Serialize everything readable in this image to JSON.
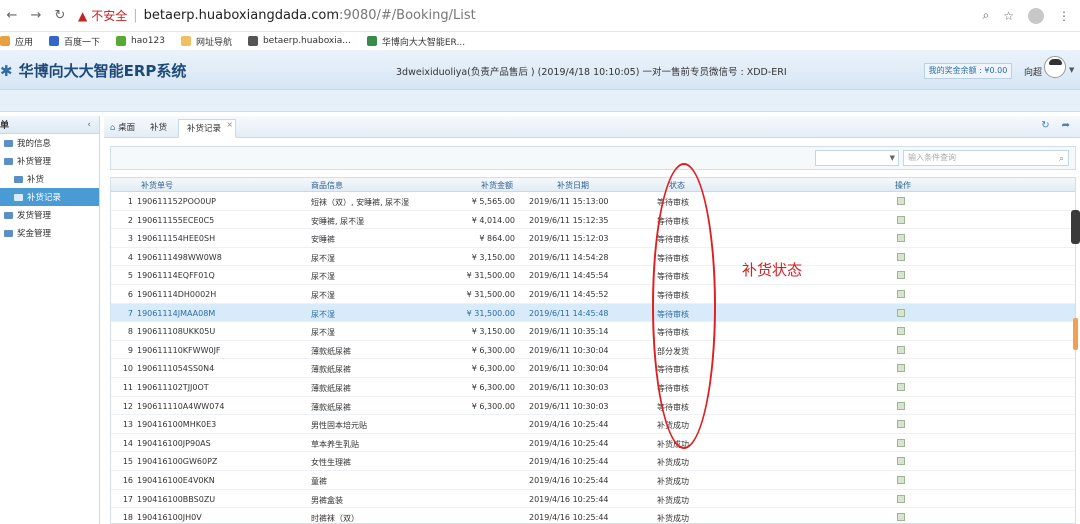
{
  "browser": {
    "insecure_label": "不安全",
    "url_host": "betaerp.huaboxiangdada.com",
    "url_path": ":9080/#/Booking/List",
    "bookmarks": [
      "应用",
      "百度一下",
      "hao123",
      "网址导航",
      "betaerp.huaboxia...",
      "华博向大大智能ER..."
    ]
  },
  "header": {
    "title": "华博向大大智能ERP系统",
    "notice": "3dweixiduoliya(负责产品售后 ) (2019/4/18 10:10:05) 一对一售前专员微信号 : XDD-ERI",
    "balance": "我的奖金余额 : ¥0.00",
    "user": "向超"
  },
  "sidebar": {
    "header": "单",
    "items": [
      {
        "label": "我的信息"
      },
      {
        "label": "补货管理"
      },
      {
        "label": "补货"
      },
      {
        "label": "补货记录"
      },
      {
        "label": "发货管理"
      },
      {
        "label": "奖金管理"
      }
    ]
  },
  "tabs": [
    "桌面",
    "补货",
    "补货记录"
  ],
  "toolbar": {
    "search_placeholder": "输入条件查询"
  },
  "table": {
    "columns": [
      "补货单号",
      "商品信息",
      "补货金额",
      "补货日期",
      "状态",
      "操作"
    ],
    "rows": [
      {
        "no": "1",
        "code": "190611152POO0UP",
        "goods": "短袜（双）, 安睡裤, 尿不湿",
        "amount": "¥ 5,565.00",
        "date": "2019/6/11 15:13:00",
        "status": "等待审核"
      },
      {
        "no": "2",
        "code": "190611155ECE0C5",
        "goods": "安睡裤, 尿不湿",
        "amount": "¥ 4,014.00",
        "date": "2019/6/11 15:12:35",
        "status": "等待审核"
      },
      {
        "no": "3",
        "code": "190611154HEE0SH",
        "goods": "安睡裤",
        "amount": "¥ 864.00",
        "date": "2019/6/11 15:12:03",
        "status": "等待审核"
      },
      {
        "no": "4",
        "code": "1906111498WW0W8",
        "goods": "尿不湿",
        "amount": "¥ 3,150.00",
        "date": "2019/6/11 14:54:28",
        "status": "等待审核"
      },
      {
        "no": "5",
        "code": "19061114EQFF01Q",
        "goods": "尿不湿",
        "amount": "¥ 31,500.00",
        "date": "2019/6/11 14:45:54",
        "status": "等待审核"
      },
      {
        "no": "6",
        "code": "19061114DH0002H",
        "goods": "尿不湿",
        "amount": "¥ 31,500.00",
        "date": "2019/6/11 14:45:52",
        "status": "等待审核"
      },
      {
        "no": "7",
        "code": "19061114JMAA08M",
        "goods": "尿不湿",
        "amount": "¥ 31,500.00",
        "date": "2019/6/11 14:45:48",
        "status": "等待审核"
      },
      {
        "no": "8",
        "code": "190611108UKK05U",
        "goods": "尿不湿",
        "amount": "¥ 3,150.00",
        "date": "2019/6/11 10:35:14",
        "status": "等待审核"
      },
      {
        "no": "9",
        "code": "190611110KFWW0JF",
        "goods": "薄款纸尿裤",
        "amount": "¥ 6,300.00",
        "date": "2019/6/11 10:30:04",
        "status": "部分发货"
      },
      {
        "no": "10",
        "code": "1906111054SS0N4",
        "goods": "薄款纸尿裤",
        "amount": "¥ 6,300.00",
        "date": "2019/6/11 10:30:04",
        "status": "等待审核"
      },
      {
        "no": "11",
        "code": "190611102TJJ0OT",
        "goods": "薄款纸尿裤",
        "amount": "¥ 6,300.00",
        "date": "2019/6/11 10:30:03",
        "status": "等待审核"
      },
      {
        "no": "12",
        "code": "190611110A4WW074",
        "goods": "薄款纸尿裤",
        "amount": "¥ 6,300.00",
        "date": "2019/6/11 10:30:03",
        "status": "等待审核"
      },
      {
        "no": "13",
        "code": "190416100MHK0E3",
        "goods": "男性固本培元贴",
        "amount": "",
        "date": "2019/4/16 10:25:44",
        "status": "补货成功"
      },
      {
        "no": "14",
        "code": "190416100JP90AS",
        "goods": "草本养生乳贴",
        "amount": "",
        "date": "2019/4/16 10:25:44",
        "status": "补货成功"
      },
      {
        "no": "15",
        "code": "190416100GW60PZ",
        "goods": "女性生理裤",
        "amount": "",
        "date": "2019/4/16 10:25:44",
        "status": "补货成功"
      },
      {
        "no": "16",
        "code": "190416100E4V0KN",
        "goods": "童裤",
        "amount": "",
        "date": "2019/4/16 10:25:44",
        "status": "补货成功"
      },
      {
        "no": "17",
        "code": "190416100BBS0ZU",
        "goods": "男裤盒装",
        "amount": "",
        "date": "2019/4/16 10:25:44",
        "status": "补货成功"
      },
      {
        "no": "18",
        "code": "190416100JH0V",
        "goods": "时裤袜（双）",
        "amount": "",
        "date": "2019/4/16 10:25:44",
        "status": "补货成功"
      }
    ],
    "selected_row": 7
  },
  "annotation": {
    "label": "补货状态",
    "color": "#e02020"
  }
}
